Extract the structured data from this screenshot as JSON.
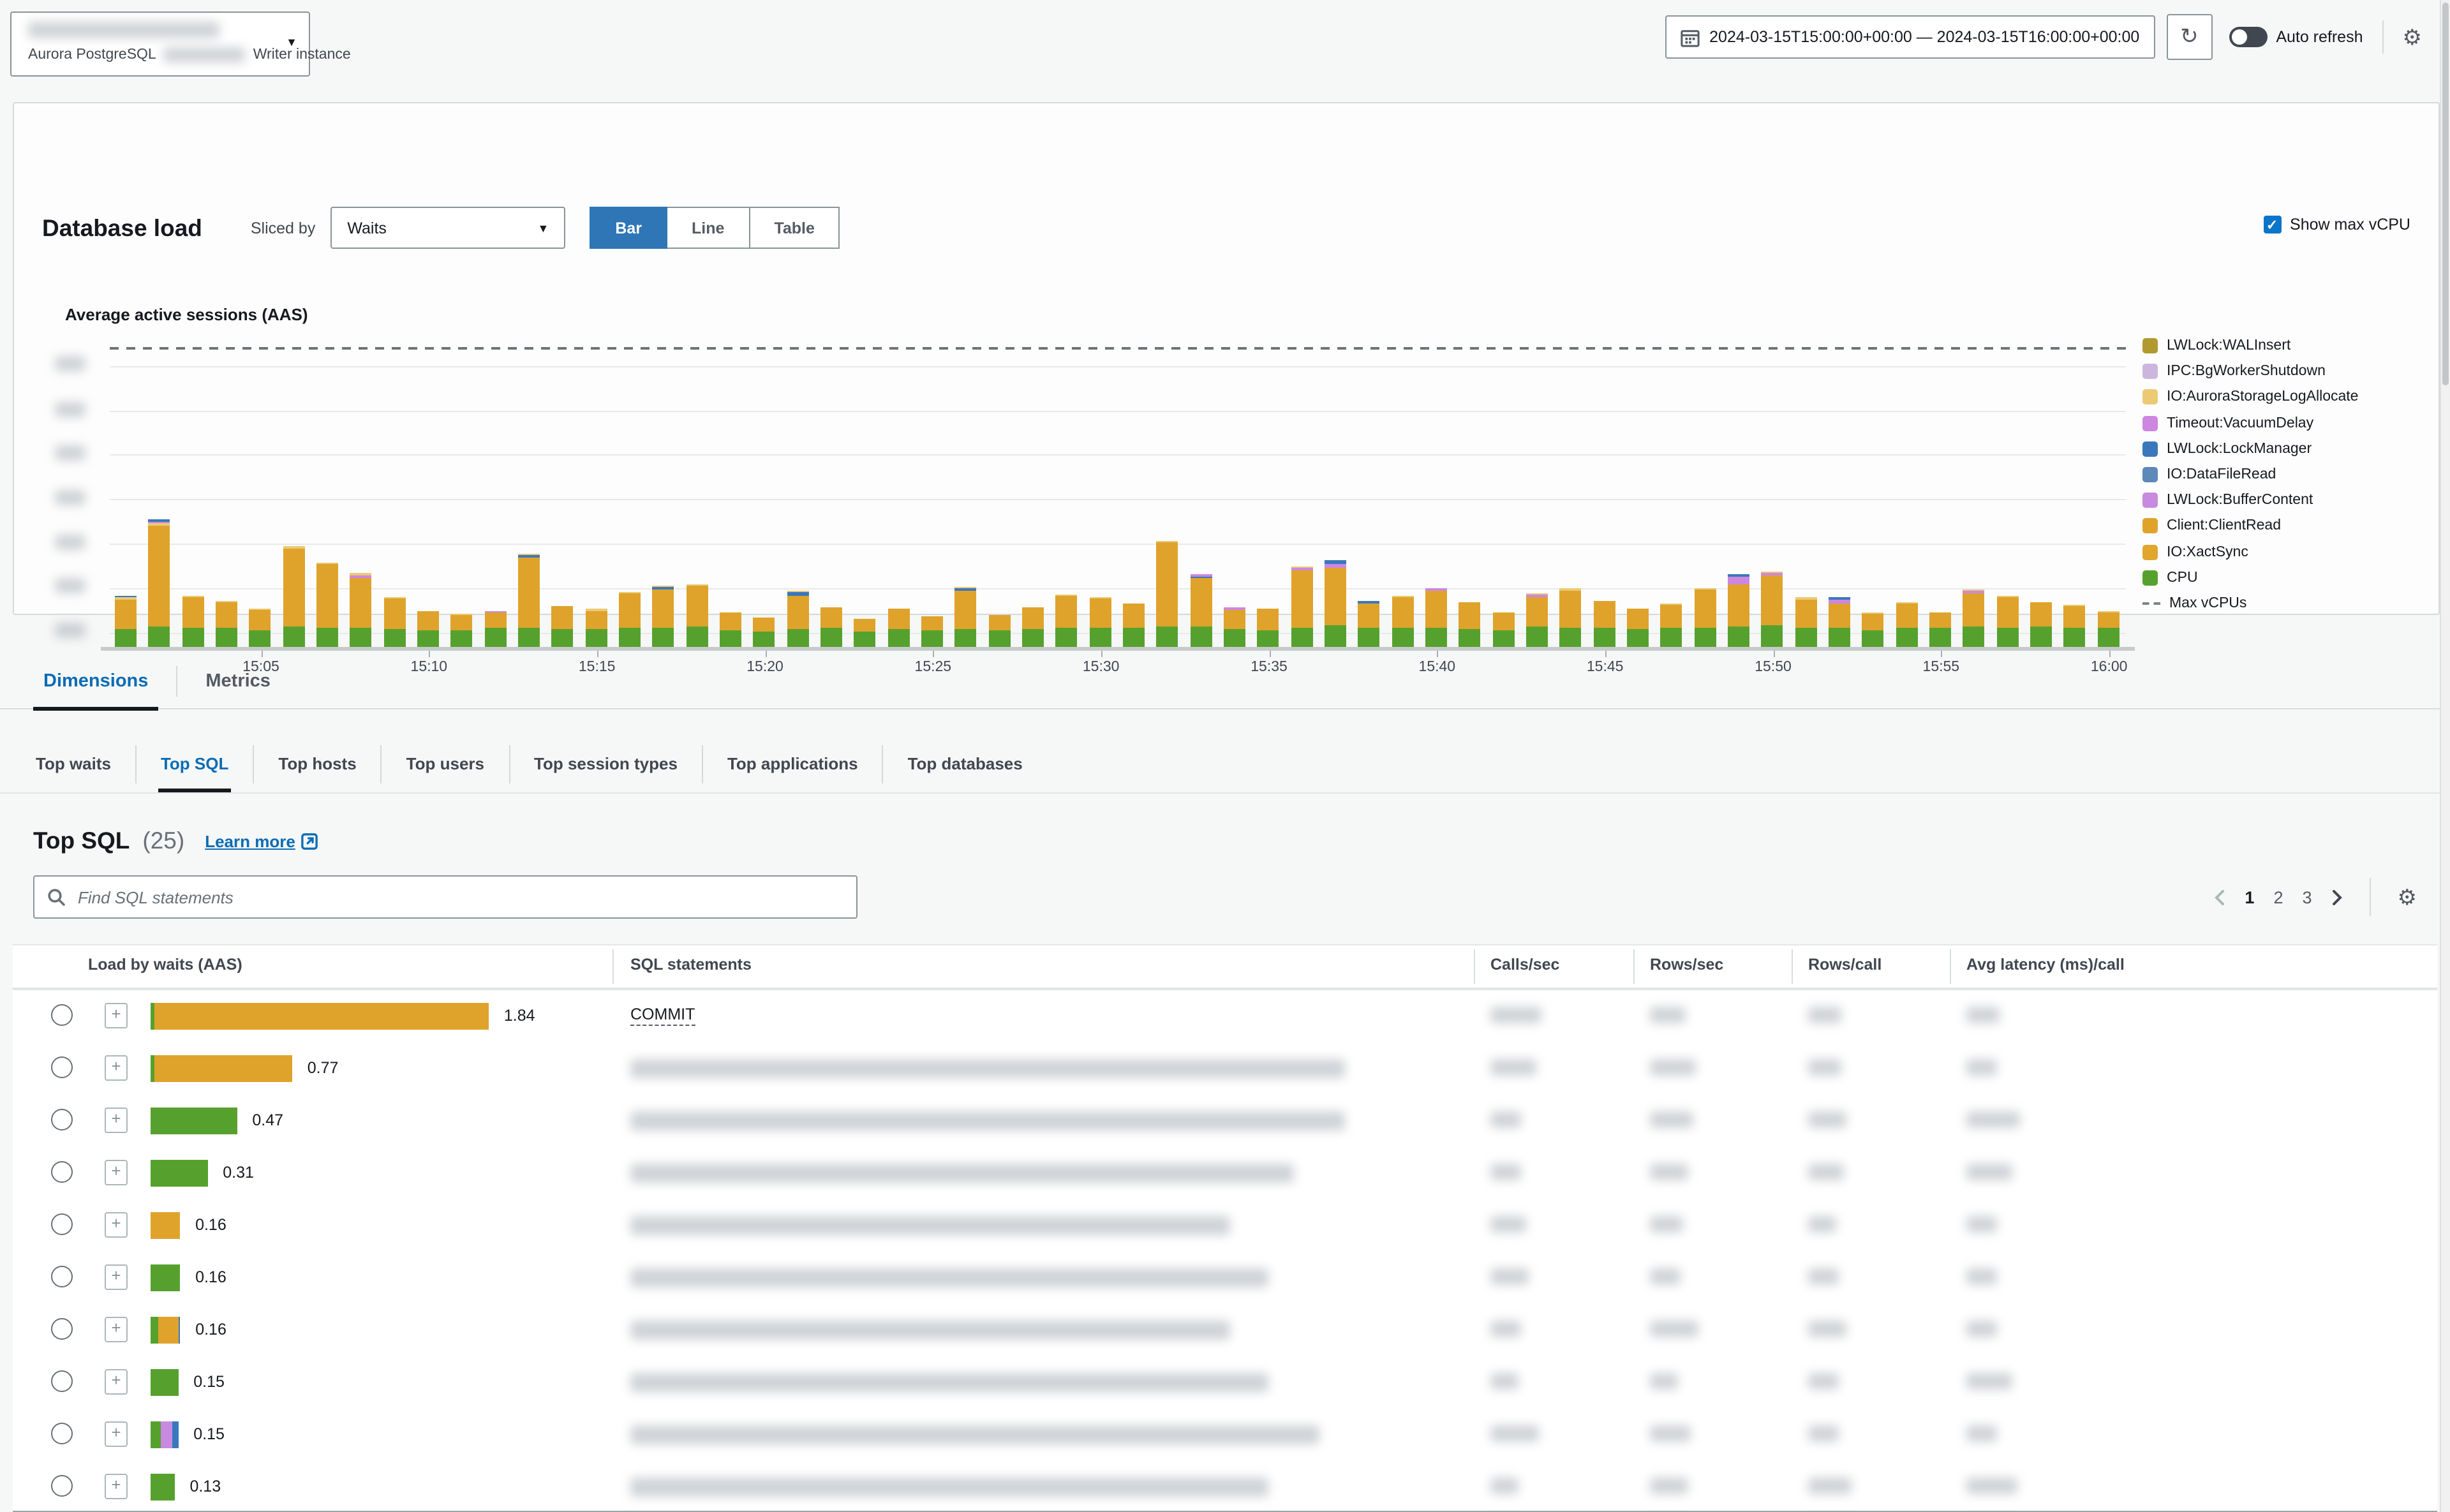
{
  "header": {
    "instance": {
      "engine": "Aurora PostgreSQL",
      "role": "Writer instance"
    },
    "time_range": "2024-03-15T15:00:00+00:00 — 2024-03-15T16:00:00+00:00",
    "auto_refresh_label": "Auto refresh"
  },
  "db_load": {
    "title": "Database load",
    "sliced_by_label": "Sliced by",
    "slice_value": "Waits",
    "view_options": [
      "Bar",
      "Line",
      "Table"
    ],
    "active_view": "Bar",
    "show_max_vcpu_label": "Show max vCPU",
    "chart_title": "Average active sessions (AAS)"
  },
  "chart_data": {
    "type": "bar",
    "stacked": true,
    "title": "Average active sessions (AAS)",
    "x_tick_labels": [
      "15:05",
      "15:10",
      "15:15",
      "15:20",
      "15:25",
      "15:30",
      "15:35",
      "15:40",
      "15:45",
      "15:50",
      "15:55",
      "16:00"
    ],
    "x_start": "15:01",
    "x_end": "16:00",
    "ylim": [
      0,
      8
    ],
    "y_labels_redacted": true,
    "max_vcpus_value": 8,
    "grid": true,
    "legend_position": "right",
    "legend": [
      {
        "label": "LWLock:WALInsert",
        "color": "#b1992f"
      },
      {
        "label": "IPC:BgWorkerShutdown",
        "color": "#cbb7dd"
      },
      {
        "label": "IO:AuroraStorageLogAllocate",
        "color": "#ecca74"
      },
      {
        "label": "Timeout:VacuumDelay",
        "color": "#cd87e0"
      },
      {
        "label": "LWLock:LockManager",
        "color": "#3a77bb"
      },
      {
        "label": "IO:DataFileRead",
        "color": "#5d88ba"
      },
      {
        "label": "LWLock:BufferContent",
        "color": "#c78ae0"
      },
      {
        "label": "Client:ClientRead",
        "color": "#dfa32b"
      },
      {
        "label": "IO:XactSync",
        "color": "#e0a62e"
      },
      {
        "label": "CPU",
        "color": "#56a12e"
      },
      {
        "label": "Max vCPUs",
        "color": "#7b8387",
        "dashed": true
      }
    ],
    "series_note": "per-minute stacked AAS: c=CPU, w=Client:ClientRead/IO:XactSync, caps=thin top segments",
    "bars": [
      {
        "c": 0.48,
        "w": 0.8,
        "caps": [
          [
            "storage",
            0.05
          ],
          [
            "lock",
            0.04
          ]
        ]
      },
      {
        "c": 0.55,
        "w": 2.7,
        "caps": [
          [
            "storage",
            0.06
          ],
          [
            "vacuum",
            0.05
          ],
          [
            "lock",
            0.05
          ]
        ]
      },
      {
        "c": 0.5,
        "w": 0.82,
        "caps": [
          [
            "storage",
            0.05
          ]
        ]
      },
      {
        "c": 0.52,
        "w": 0.68,
        "caps": [
          [
            "storage",
            0.04
          ]
        ]
      },
      {
        "c": 0.45,
        "w": 0.55,
        "caps": [
          [
            "storage",
            0.04
          ]
        ]
      },
      {
        "c": 0.55,
        "w": 2.1,
        "caps": [
          [
            "storage",
            0.05
          ]
        ]
      },
      {
        "c": 0.52,
        "w": 1.7,
        "caps": [
          [
            "storage",
            0.05
          ]
        ]
      },
      {
        "c": 0.53,
        "w": 1.32,
        "caps": [
          [
            "vacuum",
            0.08
          ],
          [
            "storage",
            0.04
          ]
        ]
      },
      {
        "c": 0.48,
        "w": 0.82,
        "caps": [
          [
            "storage",
            0.04
          ]
        ]
      },
      {
        "c": 0.46,
        "w": 0.5,
        "caps": []
      },
      {
        "c": 0.44,
        "w": 0.4,
        "caps": [
          [
            "storage",
            0.04
          ]
        ]
      },
      {
        "c": 0.5,
        "w": 0.42,
        "caps": [
          [
            "vacuum",
            0.05
          ]
        ]
      },
      {
        "c": 0.5,
        "w": 1.9,
        "caps": [
          [
            "lock",
            0.05
          ],
          [
            "storage",
            0.05
          ]
        ]
      },
      {
        "c": 0.48,
        "w": 0.62,
        "caps": []
      },
      {
        "c": 0.47,
        "w": 0.5,
        "caps": [
          [
            "storage",
            0.04
          ]
        ]
      },
      {
        "c": 0.5,
        "w": 0.92,
        "caps": [
          [
            "storage",
            0.04
          ]
        ]
      },
      {
        "c": 0.52,
        "w": 1.02,
        "caps": [
          [
            "lock",
            0.06
          ],
          [
            "storage",
            0.04
          ]
        ]
      },
      {
        "c": 0.55,
        "w": 1.08,
        "caps": [
          [
            "storage",
            0.05
          ]
        ]
      },
      {
        "c": 0.46,
        "w": 0.48,
        "caps": []
      },
      {
        "c": 0.42,
        "w": 0.38,
        "caps": []
      },
      {
        "c": 0.48,
        "w": 0.88,
        "caps": [
          [
            "lock",
            0.1
          ],
          [
            "storage",
            0.04
          ]
        ]
      },
      {
        "c": 0.5,
        "w": 0.56,
        "caps": []
      },
      {
        "c": 0.42,
        "w": 0.33,
        "caps": []
      },
      {
        "c": 0.48,
        "w": 0.53,
        "caps": []
      },
      {
        "c": 0.44,
        "w": 0.38,
        "caps": []
      },
      {
        "c": 0.48,
        "w": 1.02,
        "caps": [
          [
            "lock",
            0.08
          ],
          [
            "storage",
            0.04
          ]
        ]
      },
      {
        "c": 0.46,
        "w": 0.4,
        "caps": []
      },
      {
        "c": 0.47,
        "w": 0.6,
        "caps": []
      },
      {
        "c": 0.52,
        "w": 0.85,
        "caps": [
          [
            "storage",
            0.04
          ]
        ]
      },
      {
        "c": 0.5,
        "w": 0.8,
        "caps": [
          [
            "storage",
            0.04
          ]
        ]
      },
      {
        "c": 0.52,
        "w": 0.66,
        "caps": []
      },
      {
        "c": 0.55,
        "w": 2.25,
        "caps": [
          [
            "storage",
            0.05
          ]
        ]
      },
      {
        "c": 0.55,
        "w": 1.28,
        "caps": [
          [
            "lock",
            0.06
          ],
          [
            "vacuum",
            0.06
          ]
        ]
      },
      {
        "c": 0.48,
        "w": 0.52,
        "caps": [
          [
            "vacuum",
            0.05
          ]
        ]
      },
      {
        "c": 0.46,
        "w": 0.58,
        "caps": []
      },
      {
        "c": 0.52,
        "w": 1.52,
        "caps": [
          [
            "vacuum",
            0.08
          ],
          [
            "storage",
            0.04
          ]
        ]
      },
      {
        "c": 0.58,
        "w": 1.55,
        "caps": [
          [
            "vacuum",
            0.1
          ],
          [
            "lock",
            0.08
          ]
        ]
      },
      {
        "c": 0.5,
        "w": 0.68,
        "caps": [
          [
            "lock",
            0.05
          ]
        ]
      },
      {
        "c": 0.52,
        "w": 0.82,
        "caps": [
          [
            "storage",
            0.04
          ]
        ]
      },
      {
        "c": 0.5,
        "w": 1.02,
        "caps": [
          [
            "vacuum",
            0.07
          ]
        ]
      },
      {
        "c": 0.48,
        "w": 0.72,
        "caps": []
      },
      {
        "c": 0.46,
        "w": 0.45,
        "caps": []
      },
      {
        "c": 0.54,
        "w": 0.78,
        "caps": [
          [
            "vacuum",
            0.08
          ],
          [
            "storage",
            0.04
          ]
        ]
      },
      {
        "c": 0.5,
        "w": 1.02,
        "caps": [
          [
            "storage",
            0.04
          ]
        ]
      },
      {
        "c": 0.52,
        "w": 0.72,
        "caps": []
      },
      {
        "c": 0.48,
        "w": 0.55,
        "caps": []
      },
      {
        "c": 0.52,
        "w": 0.62,
        "caps": [
          [
            "storage",
            0.04
          ]
        ]
      },
      {
        "c": 0.52,
        "w": 1.02,
        "caps": [
          [
            "storage",
            0.05
          ]
        ]
      },
      {
        "c": 0.54,
        "w": 1.12,
        "caps": [
          [
            "vacuum",
            0.22
          ],
          [
            "lock",
            0.06
          ]
        ]
      },
      {
        "c": 0.58,
        "w": 1.35,
        "caps": [
          [
            "vacuum",
            0.05
          ],
          [
            "storage",
            0.04
          ]
        ]
      },
      {
        "c": 0.5,
        "w": 0.78,
        "caps": [
          [
            "storage",
            0.04
          ]
        ]
      },
      {
        "c": 0.52,
        "w": 0.66,
        "caps": [
          [
            "vacuum",
            0.08
          ],
          [
            "lock",
            0.06
          ]
        ]
      },
      {
        "c": 0.46,
        "w": 0.42,
        "caps": [
          [
            "storage",
            0.04
          ]
        ]
      },
      {
        "c": 0.5,
        "w": 0.66,
        "caps": [
          [
            "storage",
            0.04
          ]
        ]
      },
      {
        "c": 0.52,
        "w": 0.42,
        "caps": []
      },
      {
        "c": 0.56,
        "w": 0.88,
        "caps": [
          [
            "vacuum",
            0.06
          ],
          [
            "storage",
            0.04
          ]
        ]
      },
      {
        "c": 0.52,
        "w": 0.82,
        "caps": [
          [
            "storage",
            0.04
          ]
        ]
      },
      {
        "c": 0.55,
        "w": 0.66,
        "caps": []
      },
      {
        "c": 0.52,
        "w": 0.56,
        "caps": [
          [
            "storage",
            0.04
          ]
        ]
      },
      {
        "c": 0.5,
        "w": 0.42,
        "caps": [
          [
            "storage",
            0.04
          ]
        ]
      }
    ],
    "segment_colors": {
      "cpu": "#56a12e",
      "client_read": "#dfa32b",
      "storage": "#ecca74",
      "vacuum": "#cd87e0",
      "lock": "#3a77bb",
      "buffer": "#c78ae0",
      "datafile": "#5d88ba",
      "bgworker": "#cbb7dd"
    }
  },
  "tabs": {
    "items": [
      "Dimensions",
      "Metrics"
    ],
    "active": "Dimensions"
  },
  "subtabs": {
    "items": [
      "Top waits",
      "Top SQL",
      "Top hosts",
      "Top users",
      "Top session types",
      "Top applications",
      "Top databases"
    ],
    "active": "Top SQL"
  },
  "top_sql": {
    "title": "Top SQL",
    "count": "(25)",
    "learn_more_label": "Learn more",
    "search_placeholder": "Find SQL statements",
    "pagination": {
      "pages": [
        "1",
        "2",
        "3"
      ],
      "active": "1",
      "prev_enabled": false,
      "next_enabled": true
    },
    "columns": [
      "Load by waits (AAS)",
      "SQL statements",
      "Calls/sec",
      "Rows/sec",
      "Rows/call",
      "Avg latency (ms)/call"
    ],
    "rows": [
      {
        "load": "1.84",
        "segments": [
          [
            "cpu",
            0.02
          ],
          [
            "client_read",
            1.82
          ]
        ],
        "sql": "COMMIT",
        "sql_redacted": false,
        "metrics_redacted": true,
        "metric_widths": [
          40,
          28,
          26,
          26
        ],
        "sql_width": 0
      },
      {
        "load": "0.77",
        "segments": [
          [
            "cpu",
            0.02
          ],
          [
            "client_read",
            0.75
          ]
        ],
        "sql": "",
        "sql_redacted": true,
        "metrics_redacted": true,
        "metric_widths": [
          36,
          36,
          26,
          24
        ],
        "sql_width": 560
      },
      {
        "load": "0.47",
        "segments": [
          [
            "cpu",
            0.47
          ]
        ],
        "sql": "",
        "sql_redacted": true,
        "metrics_redacted": true,
        "metric_widths": [
          24,
          34,
          30,
          42
        ],
        "sql_width": 560
      },
      {
        "load": "0.31",
        "segments": [
          [
            "cpu",
            0.31
          ]
        ],
        "sql": "",
        "sql_redacted": true,
        "metrics_redacted": true,
        "metric_widths": [
          24,
          30,
          28,
          36
        ],
        "sql_width": 520
      },
      {
        "load": "0.16",
        "segments": [
          [
            "client_read",
            0.16
          ]
        ],
        "sql": "",
        "sql_redacted": true,
        "metrics_redacted": true,
        "metric_widths": [
          28,
          26,
          22,
          24
        ],
        "sql_width": 470
      },
      {
        "load": "0.16",
        "segments": [
          [
            "cpu",
            0.16
          ]
        ],
        "sql": "",
        "sql_redacted": true,
        "metrics_redacted": true,
        "metric_widths": [
          30,
          24,
          24,
          24
        ],
        "sql_width": 500
      },
      {
        "load": "0.16",
        "segments": [
          [
            "cpu",
            0.045
          ],
          [
            "client_read",
            0.105
          ],
          [
            "lock",
            0.01
          ]
        ],
        "sql": "",
        "sql_redacted": true,
        "metrics_redacted": true,
        "metric_widths": [
          24,
          38,
          30,
          24
        ],
        "sql_width": 470
      },
      {
        "load": "0.15",
        "segments": [
          [
            "cpu",
            0.15
          ]
        ],
        "sql": "",
        "sql_redacted": true,
        "metrics_redacted": true,
        "metric_widths": [
          22,
          22,
          24,
          36
        ],
        "sql_width": 500
      },
      {
        "load": "0.15",
        "segments": [
          [
            "cpu",
            0.055
          ],
          [
            "buffer",
            0.06
          ],
          [
            "lock",
            0.035
          ]
        ],
        "sql": "",
        "sql_redacted": true,
        "metrics_redacted": true,
        "metric_widths": [
          38,
          32,
          24,
          24
        ],
        "sql_width": 540
      },
      {
        "load": "0.13",
        "segments": [
          [
            "cpu",
            0.13
          ]
        ],
        "sql": "",
        "sql_redacted": true,
        "metrics_redacted": true,
        "metric_widths": [
          22,
          30,
          34,
          40
        ],
        "sql_width": 500
      }
    ]
  },
  "colors": {
    "accent_blue": "#2e76b5",
    "link_blue": "#0a6cb5",
    "tab_underline": "#15191e",
    "border": "#879596",
    "light_border": "#d5d9d9"
  }
}
